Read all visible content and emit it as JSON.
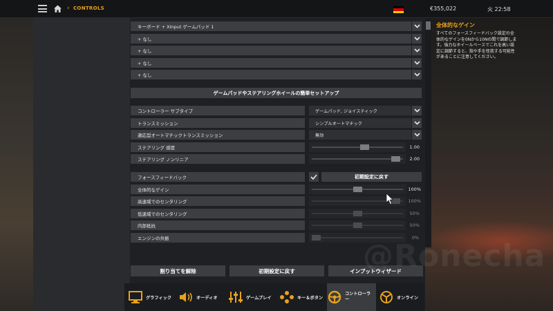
{
  "topbar": {
    "breadcrumb": "CONTROLS",
    "money": "€355,022",
    "clock": "火 22:58"
  },
  "inputs": [
    {
      "label": "キーボード + XInput ゲームパッド 1"
    },
    {
      "label": "+ なし"
    },
    {
      "label": "+ なし"
    },
    {
      "label": "+ なし"
    },
    {
      "label": "+ なし"
    }
  ],
  "setup_header": "ゲームパッドやステアリングホイールの簡単セットアップ",
  "settings": {
    "controller_subtype": {
      "label": "コントローラー サブタイプ",
      "value": "ゲームパッド, ジョイスティック"
    },
    "transmission": {
      "label": "トランスミッション",
      "value": "シンプルオートマチック"
    },
    "adaptive_auto": {
      "label": "適応型オートマチックトランスミッション",
      "value": "無効"
    },
    "steer_sensitivity": {
      "label": "ステアリング 感度",
      "value": 1.0,
      "display": "1.00",
      "fraction": 0.59
    },
    "steer_nonlinear": {
      "label": "ステアリング ノンリニア",
      "value": 2.0,
      "display": "2.00",
      "fraction": 0.97
    }
  },
  "ffb": {
    "label": "フォースフィードバック",
    "checked": true,
    "reset_label": "初期設定に戻す",
    "items": [
      {
        "label": "全体的なゲイン",
        "display": "100%",
        "fraction": 0.5,
        "enabled": true
      },
      {
        "label": "高速域でのセンタリング",
        "display": "100%",
        "fraction": 0.97,
        "enabled": false
      },
      {
        "label": "低速域でのセンタリング",
        "display": "50%",
        "fraction": 0.5,
        "enabled": false
      },
      {
        "label": "内部抵抗",
        "display": "50%",
        "fraction": 0.5,
        "enabled": false
      },
      {
        "label": "エンジンの共振",
        "display": "0%",
        "fraction": 0.0,
        "enabled": false
      }
    ]
  },
  "bottom_buttons": {
    "unassign": "割り当てを解除",
    "reset": "初期設定に戻す",
    "wizard": "インプットウィザード"
  },
  "info": {
    "title": "全体的なゲイン",
    "body": "すべてのフォースフィードバック設定の全体的なゲインを0Nから10Nの間で調節します。強力なホイールベースでこれを高い設定に調節すると、指や手を怪我する可能性があることに注意してください。"
  },
  "tabs": [
    {
      "label": "グラフィック",
      "icon": "monitor-icon"
    },
    {
      "label": "オーディオ",
      "icon": "speaker-icon"
    },
    {
      "label": "ゲームプレイ",
      "icon": "sliders-icon"
    },
    {
      "label": "キー＆ボタン",
      "icon": "buttons-icon"
    },
    {
      "label": "コントローラー",
      "icon": "steering-wheel-icon"
    },
    {
      "label": "オンライン",
      "icon": "online-icon"
    }
  ],
  "colors": {
    "accent": "#e8a21b",
    "panel": "#2a2b2e",
    "row": "#3c3e42"
  }
}
